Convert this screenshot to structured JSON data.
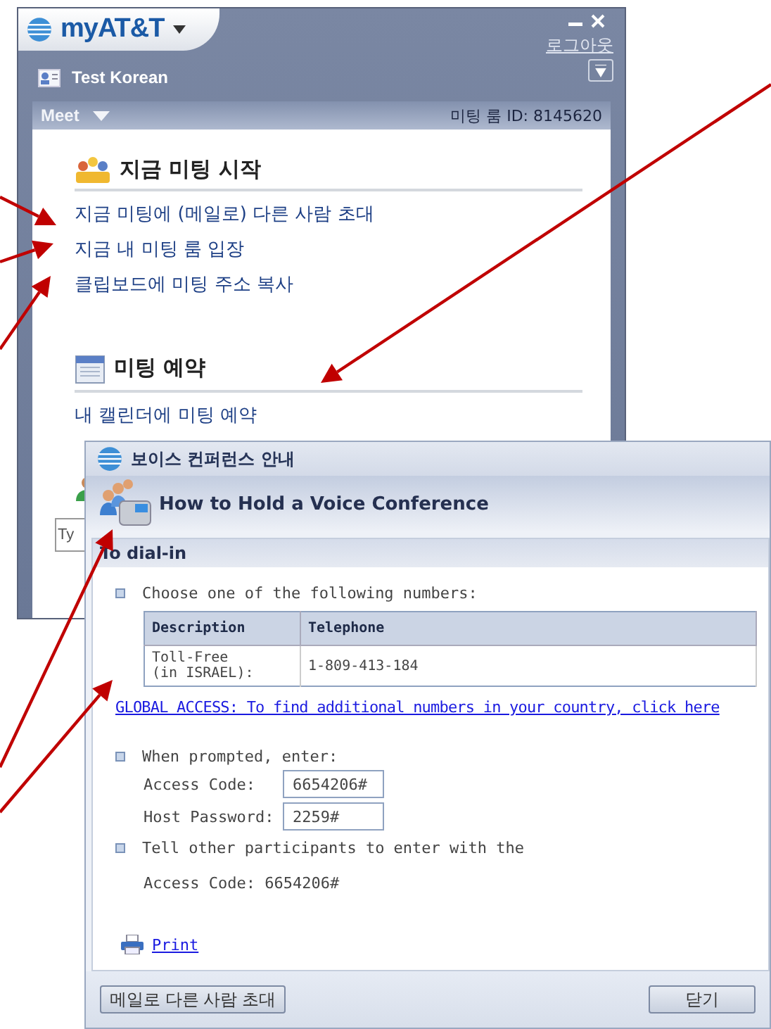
{
  "main_window": {
    "logo": "myAT&T",
    "logout": "로그아웃",
    "user": "Test Korean",
    "panel": {
      "menu": "Meet",
      "room_id": "미팅 룸 ID: 8145620"
    },
    "sections": [
      {
        "kind": "people",
        "title": "지금 미팅 시작",
        "links": [
          "지금 미팅에 (메일로) 다른 사람 초대",
          "지금 내 미팅 룸 입장",
          "클립보드에 미팅 주소 복사"
        ]
      },
      {
        "kind": "calendar",
        "title": "미팅 예약",
        "links": [
          "내 캘린더에 미팅 예약"
        ]
      }
    ],
    "chat": {
      "placeholder": "Ty"
    }
  },
  "dialog": {
    "title": "보이스 컨퍼런스 안내",
    "heading": "How to Hold a Voice Conference",
    "section": "To dial-in",
    "intro": "Choose one of the following numbers:",
    "table": {
      "columns": [
        "Description",
        "Telephone"
      ],
      "rows": [
        [
          "Toll-Free\n(in ISRAEL):",
          "1-809-413-184"
        ]
      ]
    },
    "global_link": "GLOBAL ACCESS: To find additional numbers in your country, click here",
    "prompt": "When prompted, enter:",
    "fields": [
      {
        "label": "Access Code:",
        "value": "6654206#"
      },
      {
        "label": "Host Password:",
        "value": "2259#"
      }
    ],
    "tell": "Tell other participants to enter with the",
    "tell_code": "Access Code: 6654206#",
    "print": "Print",
    "buttons": [
      "메일로 다른 사람 초대",
      "닫기"
    ]
  }
}
